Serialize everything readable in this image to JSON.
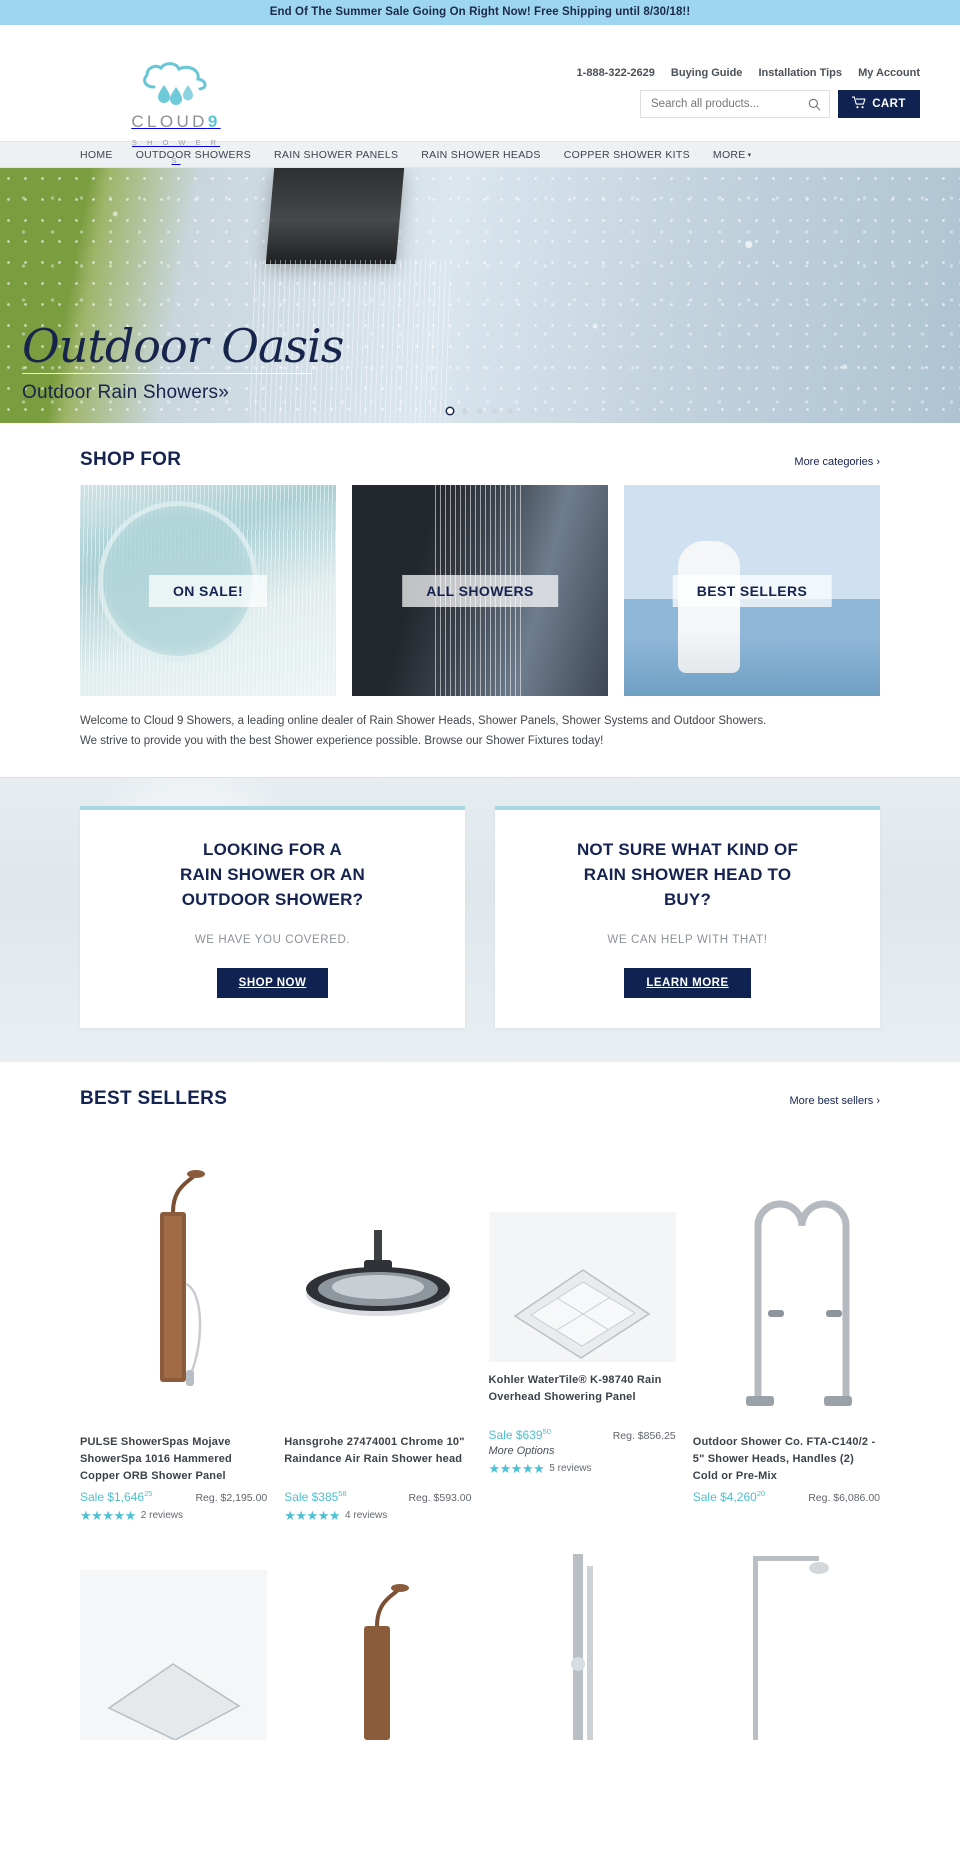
{
  "announcement": {
    "text": "End Of The Summer Sale Going On Right Now! Free Shipping until 8/30/18!!"
  },
  "brand": {
    "word": "CLOUD",
    "nine": "9",
    "sub": "S H O W E R S",
    "logo_icon": "cloud-raindrops-icon",
    "accent": "#5ec4d6"
  },
  "header": {
    "phone": "1-888-322-2629",
    "links": [
      {
        "label": "Buying Guide"
      },
      {
        "label": "Installation Tips"
      },
      {
        "label": "My Account"
      }
    ],
    "search": {
      "placeholder": "Search all products...",
      "value": "",
      "icon": "search-icon"
    },
    "cart": {
      "label": "CART",
      "icon": "cart-icon",
      "color": "#0f2252"
    }
  },
  "nav": {
    "items": [
      {
        "label": "HOME"
      },
      {
        "label": "OUTDOOR SHOWERS"
      },
      {
        "label": "RAIN SHOWER PANELS"
      },
      {
        "label": "RAIN SHOWER HEADS"
      },
      {
        "label": "COPPER SHOWER KITS"
      },
      {
        "label": "MORE",
        "caret": "▾"
      }
    ]
  },
  "hero": {
    "script_title": "Outdoor Oasis",
    "subtitle": "Outdoor Rain Showers»",
    "dots": 5,
    "active_dot": 0
  },
  "shop_for": {
    "title": "SHOP FOR",
    "more_label": "More categories ›",
    "tiles": [
      {
        "label": "ON SALE!"
      },
      {
        "label": "ALL SHOWERS"
      },
      {
        "label": "BEST SELLERS"
      }
    ],
    "welcome_line1": "Welcome to Cloud 9 Showers, a leading online dealer of Rain Shower Heads, Shower Panels, Shower Systems and Outdoor Showers.",
    "welcome_line2": "We strive to provide you with the best Shower experience possible. Browse our Shower Fixtures today!"
  },
  "promos": [
    {
      "heading_l1": "LOOKING FOR A",
      "heading_l2": "RAIN SHOWER OR AN",
      "heading_l3": "OUTDOOR SHOWER?",
      "sub": "WE HAVE YOU COVERED.",
      "button": "SHOP NOW"
    },
    {
      "heading_l1": "NOT SURE WHAT KIND OF",
      "heading_l2": "RAIN SHOWER HEAD TO",
      "heading_l3": "BUY?",
      "sub": "WE CAN HELP WITH THAT!",
      "button": "LEARN MORE"
    }
  ],
  "best_sellers": {
    "title": "BEST SELLERS",
    "more_label": "More best sellers ›",
    "products": [
      {
        "title": "PULSE ShowerSpas Mojave ShowerSpa 1016 Hammered Copper ORB Shower Panel",
        "sale_main": "Sale $1,646",
        "sale_cents": "25",
        "reg": "Reg. $2,195.00",
        "stars": "★★★★★",
        "reviews": "2 reviews",
        "more_options": ""
      },
      {
        "title": "Hansgrohe 27474001 Chrome 10\" Raindance Air Rain Shower head",
        "sale_main": "Sale $385",
        "sale_cents": "58",
        "reg": "Reg. $593.00",
        "stars": "★★★★★",
        "reviews": "4 reviews",
        "more_options": ""
      },
      {
        "title": "Kohler WaterTile® K-98740 Rain Overhead Showering Panel",
        "sale_main": "Sale $639",
        "sale_cents": "50",
        "reg": "Reg. $856.25",
        "stars": "★★★★★",
        "reviews": "5 reviews",
        "more_options": "More Options"
      },
      {
        "title": "Outdoor Shower Co. FTA-C140/2 - 5\" Shower Heads, Handles (2) Cold or Pre-Mix",
        "sale_main": "Sale $4,260",
        "sale_cents": "20",
        "reg": "Reg. $6,086.00",
        "stars": "",
        "reviews": "",
        "more_options": ""
      }
    ]
  },
  "colors": {
    "announce_bg": "#9fd6ef",
    "navy": "#0f2252",
    "teal": "#4cc0d4",
    "nav_bg": "#eef1f4"
  }
}
